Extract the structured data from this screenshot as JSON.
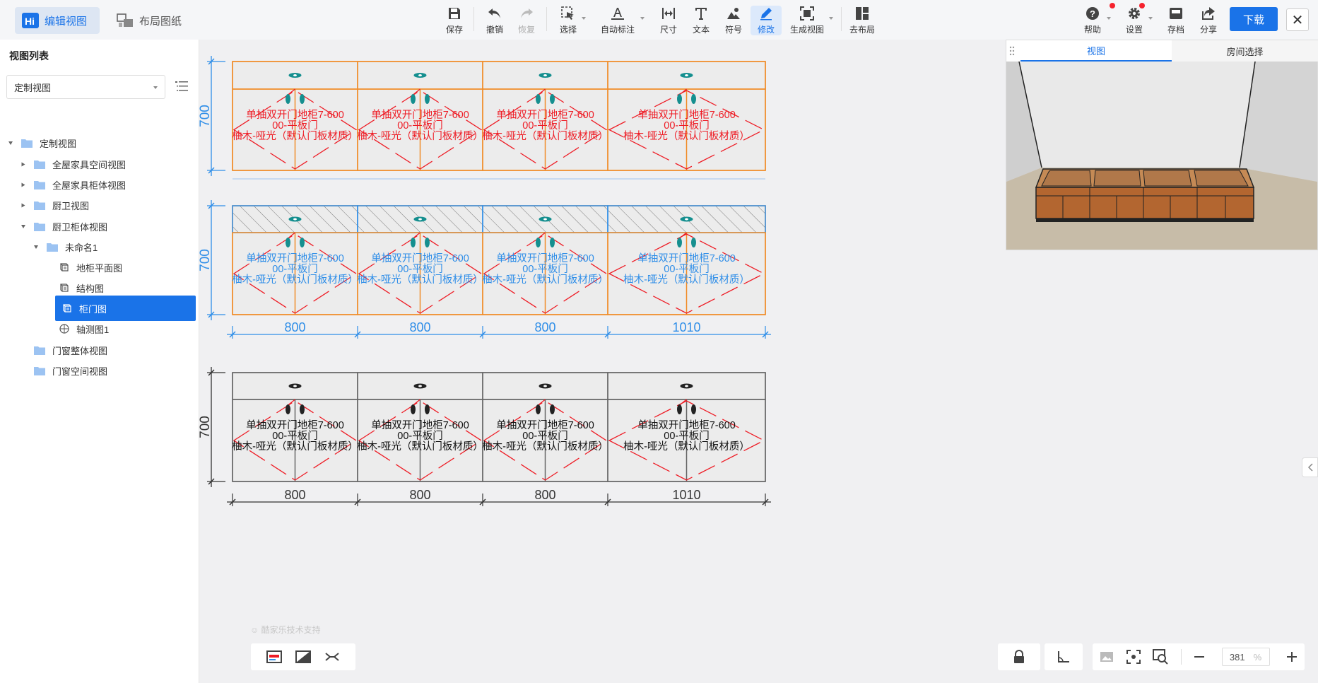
{
  "header": {
    "tabs": [
      {
        "label": "编辑视图",
        "icon": "hi-logo-icon"
      },
      {
        "label": "布局图纸",
        "icon": "layout-sheet-icon"
      }
    ],
    "tools": [
      {
        "label": "保存",
        "icon": "save-icon"
      },
      {
        "label": "撤销",
        "icon": "undo-icon"
      },
      {
        "label": "恢复",
        "icon": "redo-icon",
        "disabled": true
      },
      {
        "label": "选择",
        "icon": "select-icon"
      },
      {
        "label": "自动标注",
        "icon": "auto-annotate-icon"
      },
      {
        "label": "尺寸",
        "icon": "dimension-icon"
      },
      {
        "label": "文本",
        "icon": "text-icon"
      },
      {
        "label": "符号",
        "icon": "symbol-icon"
      },
      {
        "label": "修改",
        "icon": "edit-pen-icon",
        "active": true
      },
      {
        "label": "生成视图",
        "icon": "generate-view-icon"
      },
      {
        "label": "去布局",
        "icon": "to-layout-icon"
      }
    ],
    "right_tools": [
      {
        "label": "帮助",
        "icon": "help-icon"
      },
      {
        "label": "设置",
        "icon": "gear-icon"
      },
      {
        "label": "存档",
        "icon": "archive-icon"
      },
      {
        "label": "分享",
        "icon": "share-icon"
      }
    ],
    "download_label": "下载",
    "close_label": "✕"
  },
  "sidebar": {
    "title": "视图列表",
    "select_value": "定制视图",
    "tree": [
      {
        "label": "定制视图",
        "level": 0,
        "expanded": true,
        "icon": "folder-icon"
      },
      {
        "label": "全屋家具空间视图",
        "level": 1,
        "expanded": false,
        "icon": "folder-icon"
      },
      {
        "label": "全屋家具柜体视图",
        "level": 1,
        "expanded": false,
        "icon": "folder-icon"
      },
      {
        "label": "厨卫视图",
        "level": 1,
        "expanded": false,
        "icon": "folder-icon"
      },
      {
        "label": "厨卫柜体视图",
        "level": 1,
        "expanded": true,
        "icon": "folder-icon"
      },
      {
        "label": "未命名1",
        "level": 2,
        "expanded": true,
        "icon": "folder-icon"
      },
      {
        "label": "地柜平面图",
        "level": 3,
        "icon": "cube-view-icon"
      },
      {
        "label": "结构图",
        "level": 3,
        "icon": "cube-view-icon"
      },
      {
        "label": "柜门图",
        "level": 3,
        "icon": "cube-view-icon",
        "selected": true
      },
      {
        "label": "轴测图1",
        "level": 3,
        "icon": "axonometric-icon"
      },
      {
        "label": "门窗整体视图",
        "level": 1,
        "icon": "folder-icon"
      },
      {
        "label": "门窗空间视图",
        "level": 1,
        "icon": "folder-icon"
      }
    ]
  },
  "drawing": {
    "cabinet_label": [
      "单抽双开门地柜7-600",
      "00-平板门",
      "柚木-哑光（默认门板材质）"
    ],
    "height_label": "700",
    "widths": [
      "800",
      "800",
      "800",
      "1010"
    ],
    "colors": {
      "orange": "#f08c28",
      "blue": "#2f8ee8",
      "red": "#ee1c25",
      "gray": "#666666"
    }
  },
  "preview": {
    "tabs": [
      "视图",
      "房间选择"
    ]
  },
  "footer": {
    "support": "酷家乐技术支持",
    "zoom": "381",
    "zoom_unit": "%"
  }
}
